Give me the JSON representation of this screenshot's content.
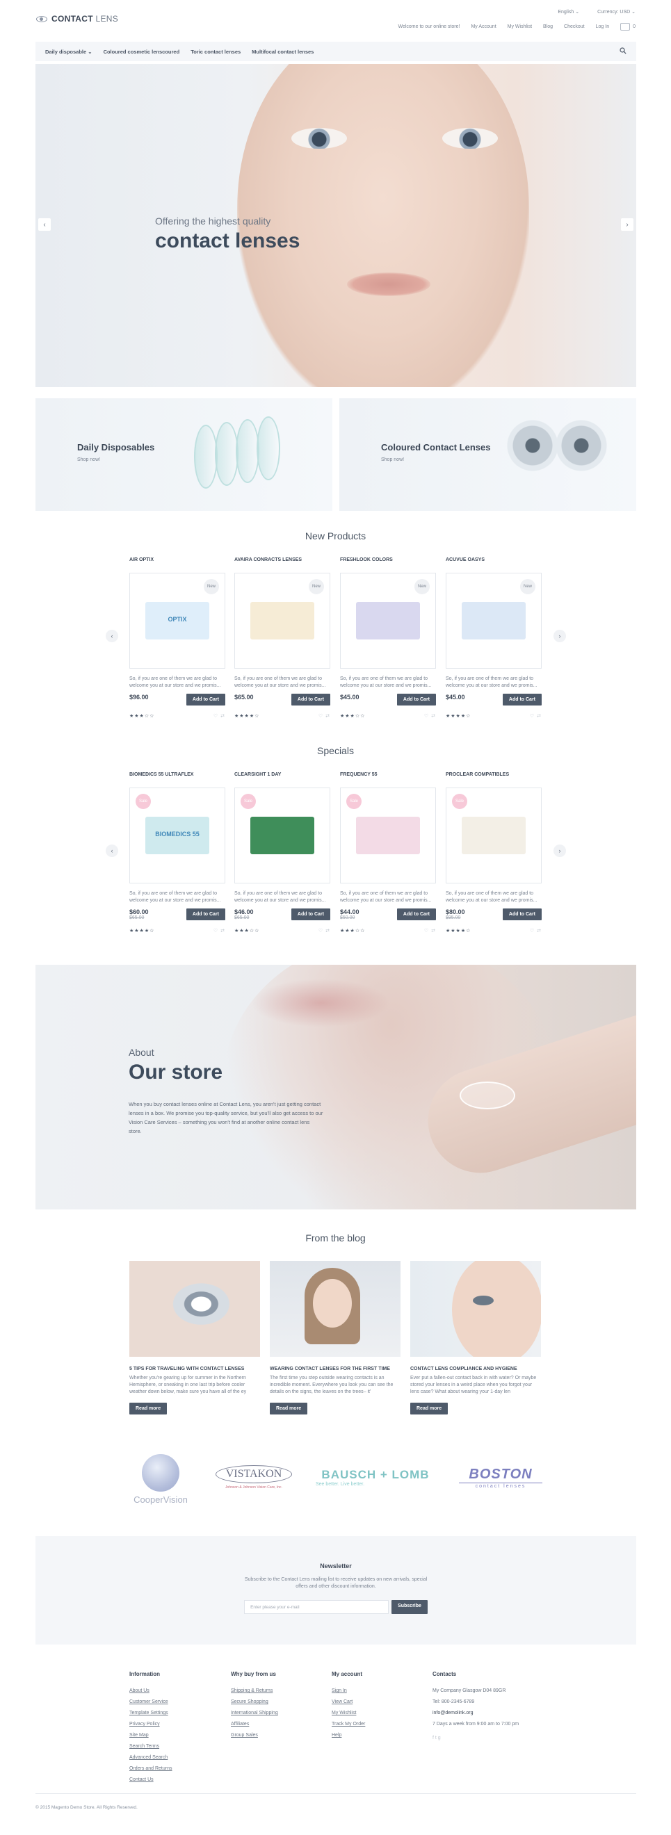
{
  "header": {
    "brand_bold": "CONTACT",
    "brand_light": " LENS",
    "language": "English ⌄",
    "currency": "Currency: USD ⌄",
    "welcome": "Welcome to our online store!",
    "links": [
      "My Account",
      "My Wishlist",
      "Blog",
      "Checkout",
      "Log In"
    ],
    "cart_count": "0"
  },
  "nav": {
    "items": [
      "Daily disposable ⌄",
      "Coloured cosmetic lenscoured",
      "Toric contact lenses",
      "Multifocal contact lenses"
    ]
  },
  "hero": {
    "subtitle": "Offering the highest quality",
    "title": "contact lenses",
    "prev": "‹",
    "next": "›"
  },
  "promos": [
    {
      "title": "Daily Disposables",
      "link": "Shop now!"
    },
    {
      "title": "Coloured Contact Lenses",
      "link": "Shop now!"
    }
  ],
  "new_products": {
    "title": "New Products",
    "items": [
      {
        "name": "AIR OPTIX",
        "badge": "New",
        "desc": "So, if you are one of them we are glad to welcome you at our store and we promis...",
        "price": "$96.00",
        "old": "",
        "button": "Add to Cart",
        "stars": "★★★☆☆",
        "icons": "♡ ⇄",
        "box_color": "#dfeefa",
        "box_label": "OPTIX"
      },
      {
        "name": "AVAIRA CONRACTS LENSES",
        "badge": "New",
        "desc": "So, if you are one of them we are glad to welcome you at our store and we promis...",
        "price": "$65.00",
        "old": "",
        "button": "Add to Cart",
        "stars": "★★★★☆",
        "icons": "♡ ⇄",
        "box_color": "#f6ecd6",
        "box_label": ""
      },
      {
        "name": "FRESHLOOK COLORS",
        "badge": "New",
        "desc": "So, if you are one of them we are glad to welcome you at our store and we promis...",
        "price": "$45.00",
        "old": "",
        "button": "Add to Cart",
        "stars": "★★★☆☆",
        "icons": "♡ ⇄",
        "box_color": "#d9d8ef",
        "box_label": ""
      },
      {
        "name": "ACUVUE OASYS",
        "badge": "New",
        "desc": "So, if you are one of them we are glad to welcome you at our store and we promis...",
        "price": "$45.00",
        "old": "",
        "button": "Add to Cart",
        "stars": "★★★★☆",
        "icons": "♡ ⇄",
        "box_color": "#dce8f6",
        "box_label": ""
      }
    ]
  },
  "specials": {
    "title": "Specials",
    "items": [
      {
        "name": "BIOMEDICS 55 ULTRAFLEX",
        "badge": "Sale",
        "desc": "So, if you are one of them we are glad to welcome you at our store and we promis...",
        "price": "$60.00",
        "old": "$65.00",
        "button": "Add to Cart",
        "stars": "★★★★☆",
        "icons": "♡ ⇄",
        "box_color": "#cfeaee",
        "box_label": "BIOMEDICS 55"
      },
      {
        "name": "CLEARSIGHT 1 DAY",
        "badge": "Sale",
        "desc": "So, if you are one of them we are glad to welcome you at our store and we promis...",
        "price": "$46.00",
        "old": "$65.00",
        "button": "Add to Cart",
        "stars": "★★★☆☆",
        "icons": "♡ ⇄",
        "box_color": "#3f8e5a",
        "box_label": ""
      },
      {
        "name": "FREQUENCY 55",
        "badge": "Sale",
        "desc": "So, if you are one of them we are glad to welcome you at our store and we promis...",
        "price": "$44.00",
        "old": "$50.00",
        "button": "Add to Cart",
        "stars": "★★★☆☆",
        "icons": "♡ ⇄",
        "box_color": "#f3dbe6",
        "box_label": ""
      },
      {
        "name": "PROCLEAR COMPATIBLES",
        "badge": "Sale",
        "desc": "So, if you are one of them we are glad to welcome you at our store and we promis...",
        "price": "$80.00",
        "old": "$95.00",
        "button": "Add to Cart",
        "stars": "★★★★☆",
        "icons": "♡ ⇄",
        "box_color": "#f3efe6",
        "box_label": ""
      }
    ]
  },
  "about": {
    "kicker": "About",
    "title": "Our store",
    "text": "When you buy contact lenses online at Contact Lens, you aren't just getting contact lenses in a box. We promise you top-quality service, but you'll also get access to our Vision Care Services – something you won't find at another online contact lens store."
  },
  "blog": {
    "title": "From the blog",
    "posts": [
      {
        "title": "5 TIPS FOR TRAVELING WITH CONTACT LENSES",
        "text": "Whether you're gearing up for summer in the Northern Hemisphere, or sneaking in one last trip before cooler weather down below, make sure you have all of the ey",
        "button": "Read more"
      },
      {
        "title": "WEARING CONTACT LENSES FOR THE FIRST TIME",
        "text": "The first time you step outside wearing contacts is an incredible moment. Everywhere you look you can see the details on the signs, the leaves on the trees– it'",
        "button": "Read more"
      },
      {
        "title": "CONTACT LENS COMPLIANCE AND HYGIENE",
        "text": "Ever put a fallen-out contact back in with water? Or maybe stored your lenses in a weird place when you forgot your lens case? What about wearing your 1-day len",
        "button": "Read more"
      }
    ]
  },
  "brands": {
    "cooper": "CooperVision",
    "vistakon": "VISTAKON",
    "vistakon_sub": "Johnson & Johnson Vision Care, Inc.",
    "bausch": "BAUSCH + LOMB",
    "bausch_sub": "See better. Live better.",
    "boston": "BOSTON",
    "boston_sub": "contact lenses"
  },
  "newsletter": {
    "title": "Newsletter",
    "desc": "Subscribe to the Contact Lens mailing list to receive updates on new arrivals, special offers and other discount information.",
    "placeholder": "Enter please your e-mail",
    "button": "Subscribe"
  },
  "footer": {
    "information": {
      "title": "Information",
      "links": [
        "About Us",
        "Customer Service",
        "Template Settings",
        "Privacy Policy",
        "Site Map",
        "Search Terms",
        "Advanced Search",
        "Orders and Returns",
        "Contact Us"
      ]
    },
    "why": {
      "title": "Why buy from us",
      "links": [
        "Shipping & Returns",
        "Secure Shopping",
        "International Shipping",
        "Affiliates",
        "Group Sales"
      ]
    },
    "account": {
      "title": "My account",
      "links": [
        "Sign In",
        "View Cart",
        "My Wishlist",
        "Track My Order",
        "Help"
      ]
    },
    "contacts": {
      "title": "Contacts",
      "lines": [
        "My Company Glasgow D04 89GR",
        "Tel: 800-2345-6789",
        "info@demolink.org",
        "7 Days a week from 9:00 am to 7:00 pm"
      ],
      "social": "f  t  g"
    },
    "copyright": "© 2015 Magento Demo Store. All Rights Reserved."
  }
}
